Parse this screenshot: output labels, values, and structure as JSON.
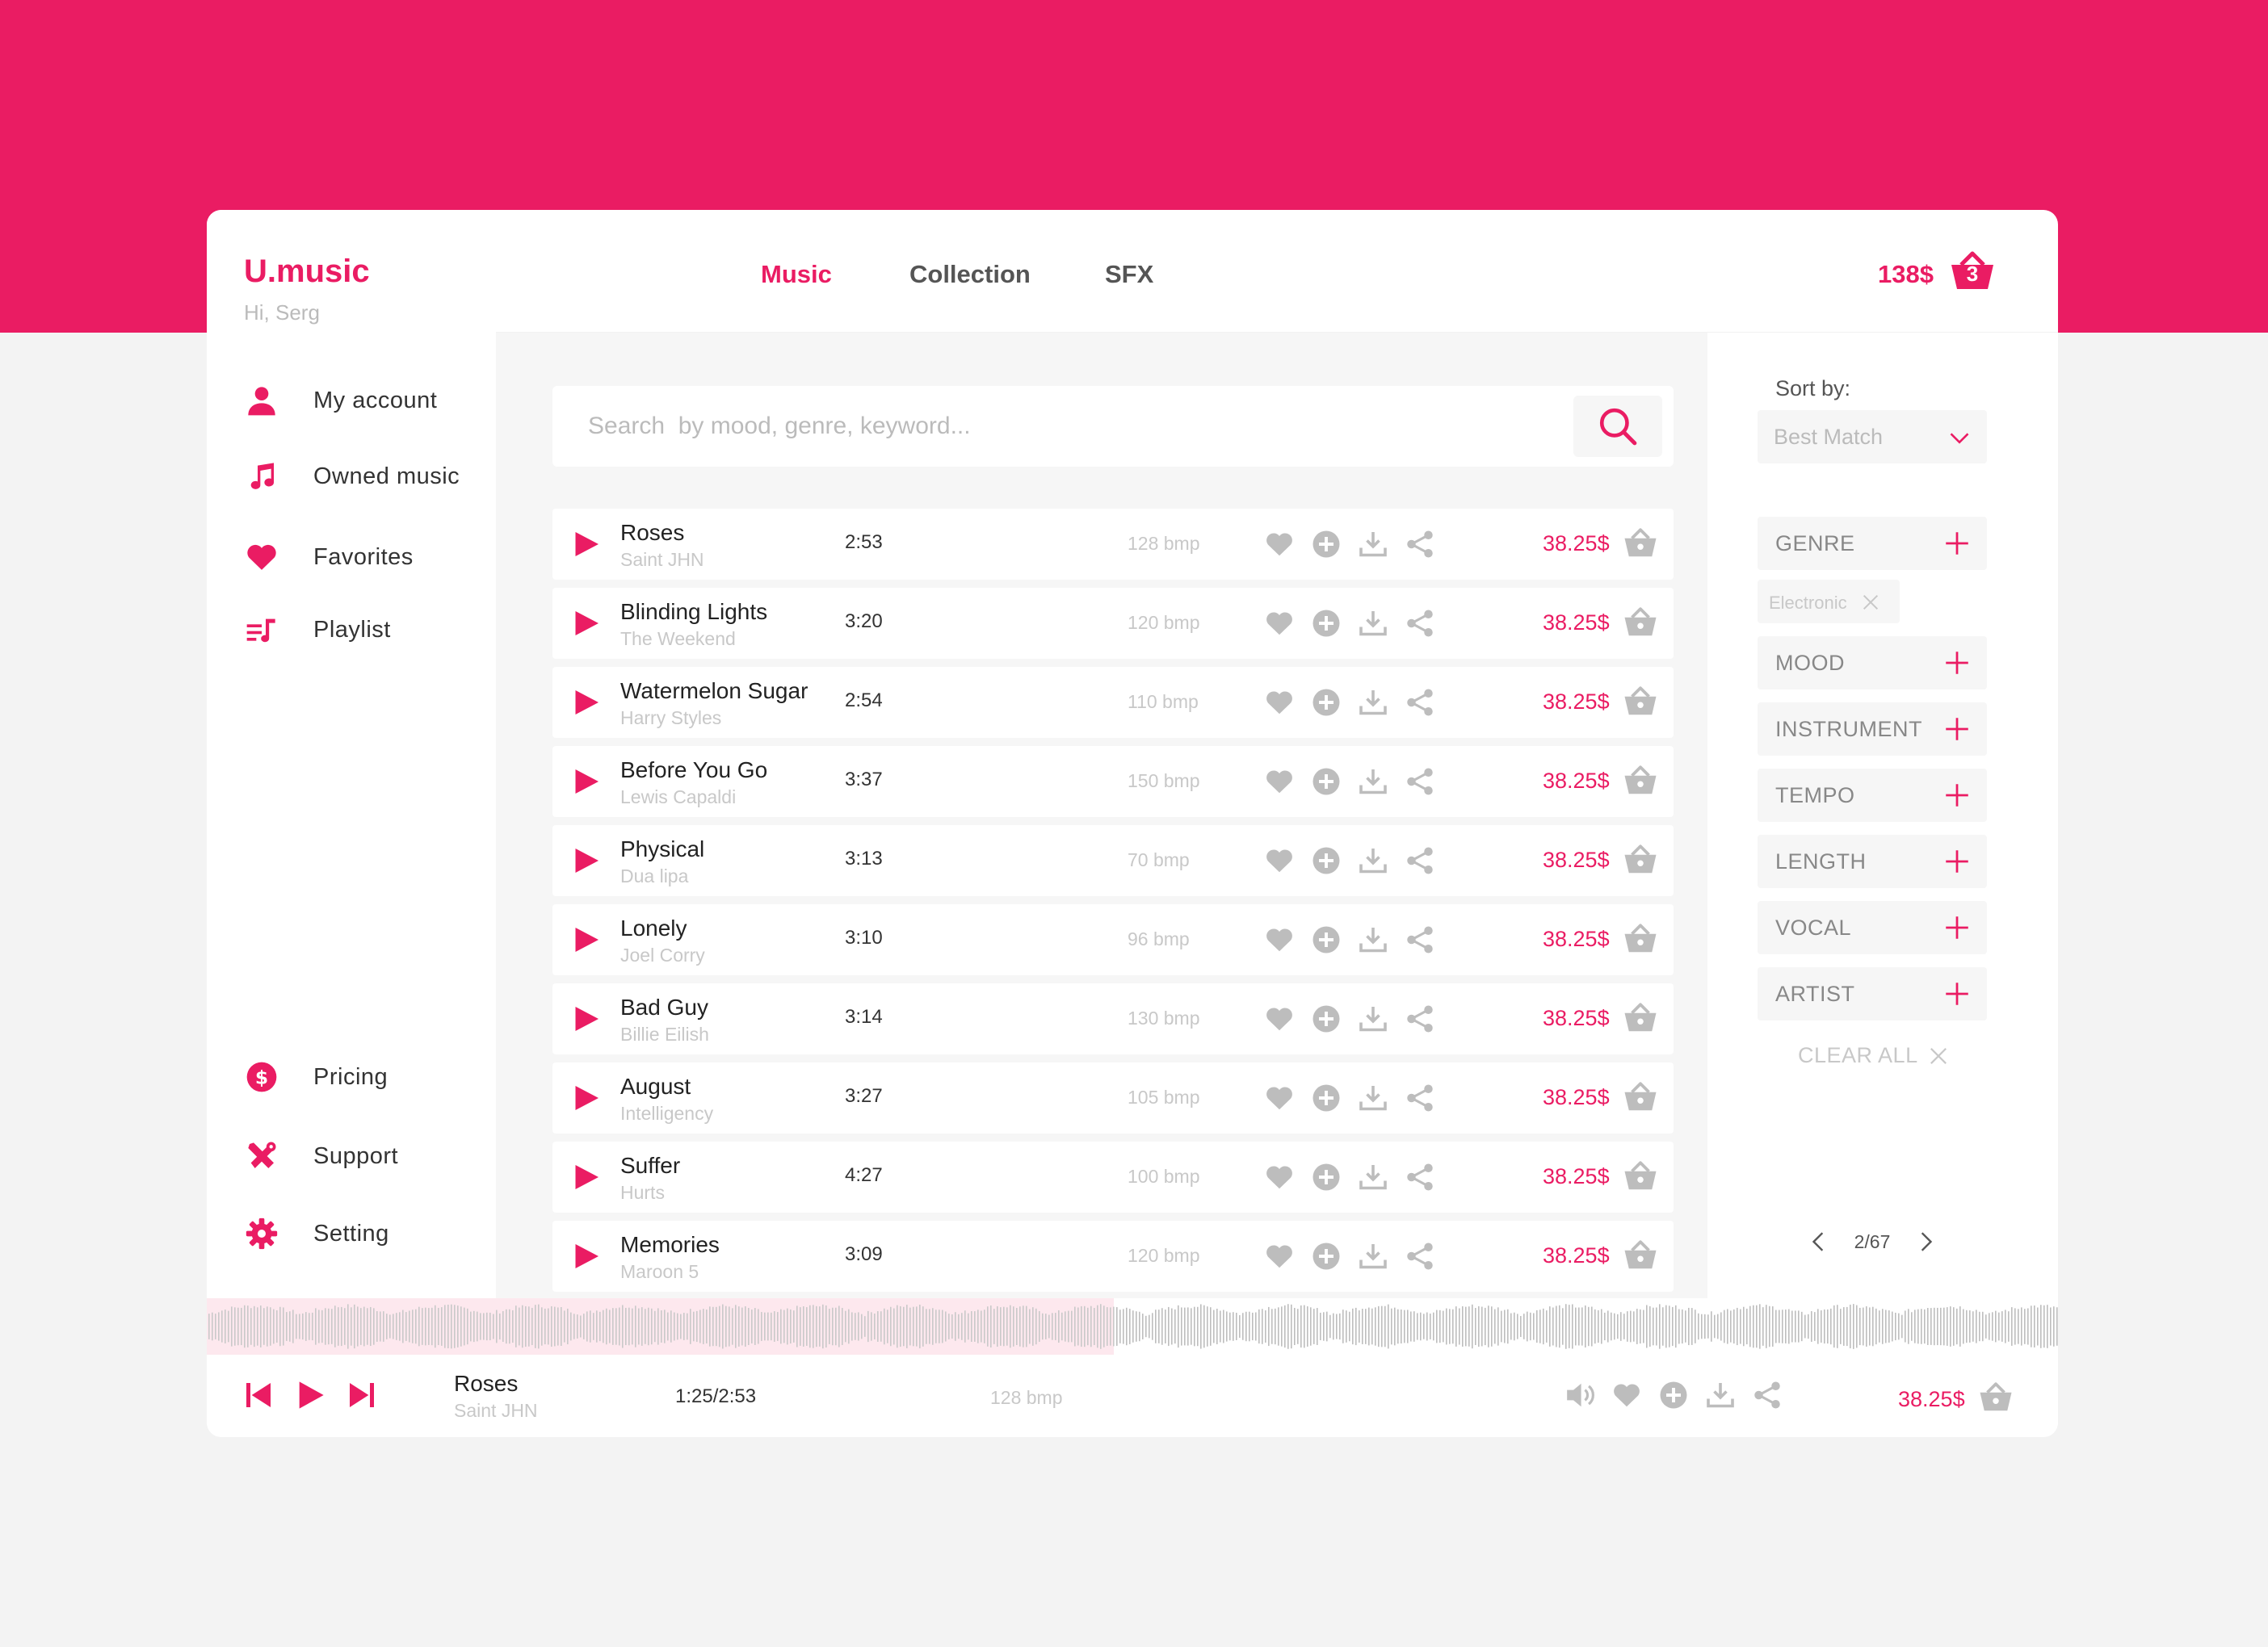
{
  "app": {
    "brand": "U.music",
    "greeting": "Hi, Serg"
  },
  "colors": {
    "accent": "#ea1c63",
    "muted": "#c8c8c8",
    "icon_grey": "#bdbdbd",
    "panel_bg": "#f6f6f6"
  },
  "nav": {
    "top": [
      {
        "label": "My account",
        "icon": "user-icon"
      },
      {
        "label": "Owned music",
        "icon": "music-note-icon"
      },
      {
        "label": "Favorites",
        "icon": "heart-icon"
      },
      {
        "label": "Playlist",
        "icon": "playlist-icon"
      }
    ],
    "bottom": [
      {
        "label": "Pricing",
        "icon": "dollar-icon"
      },
      {
        "label": "Support",
        "icon": "tools-icon"
      },
      {
        "label": "Setting",
        "icon": "gear-icon"
      }
    ]
  },
  "tabs": [
    {
      "label": "Music",
      "active": true
    },
    {
      "label": "Collection",
      "active": false
    },
    {
      "label": "SFX",
      "active": false
    }
  ],
  "cart": {
    "total": "138$",
    "count": "3"
  },
  "search": {
    "placeholder": "Search  by mood, genre, keyword...",
    "value": ""
  },
  "tracks": [
    {
      "title": "Roses",
      "artist": "Saint JHN",
      "duration": "2:53",
      "bpm": "128 bmp",
      "price": "38.25$"
    },
    {
      "title": "Blinding Lights",
      "artist": "The Weekend",
      "duration": "3:20",
      "bpm": "120 bmp",
      "price": "38.25$"
    },
    {
      "title": "Watermelon Sugar",
      "artist": "Harry Styles",
      "duration": "2:54",
      "bpm": "110 bmp",
      "price": "38.25$"
    },
    {
      "title": "Before You Go",
      "artist": "Lewis Capaldi",
      "duration": "3:37",
      "bpm": "150 bmp",
      "price": "38.25$"
    },
    {
      "title": "Physical",
      "artist": "Dua lipa",
      "duration": "3:13",
      "bpm": "70 bmp",
      "price": "38.25$"
    },
    {
      "title": "Lonely",
      "artist": "Joel Corry",
      "duration": "3:10",
      "bpm": "96 bmp",
      "price": "38.25$"
    },
    {
      "title": "Bad Guy",
      "artist": "Billie Eilish",
      "duration": "3:14",
      "bpm": "130 bmp",
      "price": "38.25$"
    },
    {
      "title": "August",
      "artist": "Intelligency",
      "duration": "3:27",
      "bpm": "105 bmp",
      "price": "38.25$"
    },
    {
      "title": "Suffer",
      "artist": "Hurts",
      "duration": "4:27",
      "bpm": "100 bmp",
      "price": "38.25$"
    },
    {
      "title": "Memories",
      "artist": "Maroon 5",
      "duration": "3:09",
      "bpm": "120 bmp",
      "price": "38.25$"
    }
  ],
  "sort": {
    "label": "Sort by:",
    "value": "Best Match"
  },
  "filters": {
    "groups": [
      "GENRE",
      "MOOD",
      "INSTRUMENT",
      "TEMPO",
      "LENGTH",
      "VOCAL",
      "ARTIST"
    ],
    "active_chip": "Electronic",
    "clear_all": "CLEAR ALL"
  },
  "pagination": {
    "label": "2/67"
  },
  "player": {
    "title": "Roses",
    "artist": "Saint JHN",
    "time": "1:25/2:53",
    "bpm": "128 bmp",
    "price": "38.25$",
    "progress": 0.49
  }
}
